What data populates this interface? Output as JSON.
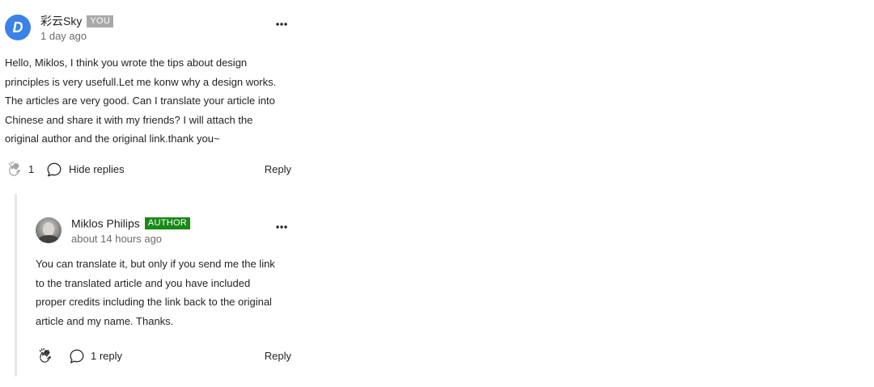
{
  "comments": [
    {
      "avatar_letter": "D",
      "author": "彩云Sky",
      "badge": "YOU",
      "time": "1 day ago",
      "text": "Hello, Miklos, I think you wrote the tips about design\nprinciples is very usefull.Let me konw why a design works.\nThe articles are very good. Can I translate your article into\nChinese and share it with my friends? I will attach the\noriginal author and the original link.thank you~",
      "clap_count": "1",
      "replies_label": "Hide replies",
      "reply_label": "Reply"
    },
    {
      "author": "Miklos Philips",
      "badge": "AUTHOR",
      "time": "about 14 hours ago",
      "text": "You can translate it, but only if you send me the link\nto the translated article and you have included\nproper credits including the link back to the original\narticle and my name. Thanks.",
      "replies_label": "1 reply",
      "reply_label": "Reply"
    }
  ],
  "colors": {
    "avatar_blue": "#3b82e8",
    "you_badge": "#a9a9a9",
    "author_badge": "#1a8917",
    "thread_line": "#e6e6e6",
    "muted_text": "#6b6b6b"
  },
  "icons": {
    "more": "more-horizontal-icon",
    "clap": "clap-icon",
    "reply": "speech-bubble-icon"
  }
}
